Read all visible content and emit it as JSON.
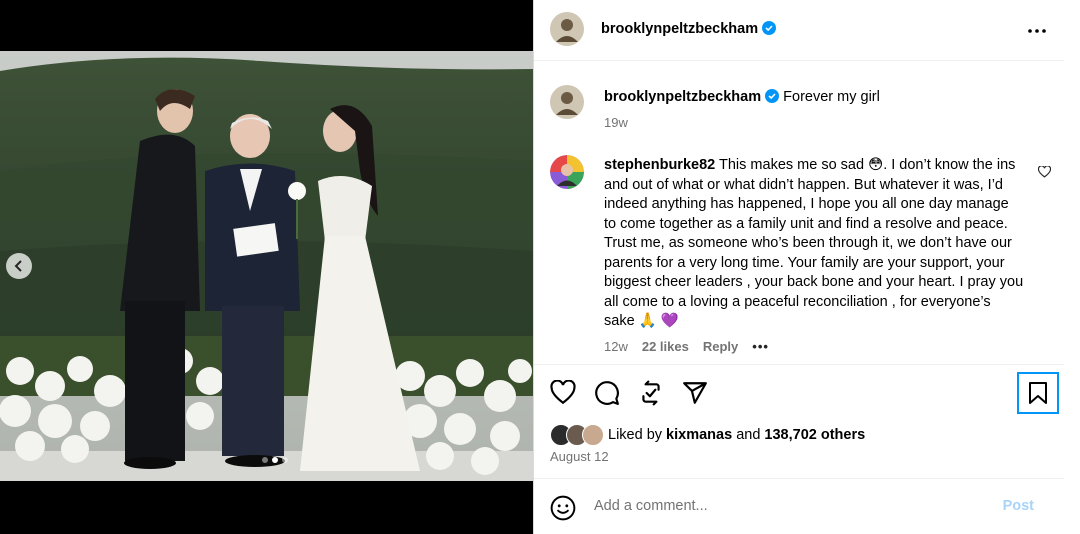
{
  "post": {
    "username": "brooklynpeltzbeckham",
    "verified": true,
    "avatar_icon": "profile-photo-icon",
    "more_icon": "more-horizontal-icon"
  },
  "caption": {
    "username": "brooklynpeltzbeckham",
    "text": "Forever my girl",
    "age": "19w"
  },
  "comment": {
    "username": "stephenburke82",
    "text": "This makes me so sad 😳. I don’t know the ins and out of what or what didn’t happen. But whatever it was, I’d indeed anything has happened, I hope you all one day manage to come together as a family unit and find a resolve and peace. Trust me, as someone who’s been through it, we don’t have our parents for a very long time. Your family are your support, your biggest cheer leaders , your back bone and your heart. I pray you all come to a loving a peaceful reconciliation , for everyone’s sake 🙏 💜",
    "age": "12w",
    "likes": "22 likes",
    "reply": "Reply",
    "more": "•••"
  },
  "actions": {
    "like_icon": "heart-icon",
    "comment_icon": "comment-icon",
    "share_icon": "repost-icon",
    "send_icon": "send-icon",
    "save_icon": "bookmark-icon"
  },
  "likes": {
    "prefix": "Liked by",
    "user": "kixmanas",
    "and": "and",
    "count": "138,702 others"
  },
  "date": "August 12",
  "add_comment": {
    "placeholder": "Add a comment...",
    "post_label": "Post"
  },
  "media": {
    "carousel_dots": 3,
    "active_dot": 1
  },
  "colors": {
    "verified": "#0095f6",
    "link": "#0095f6",
    "muted": "#737373",
    "post_disabled": "#a8d4fb"
  }
}
